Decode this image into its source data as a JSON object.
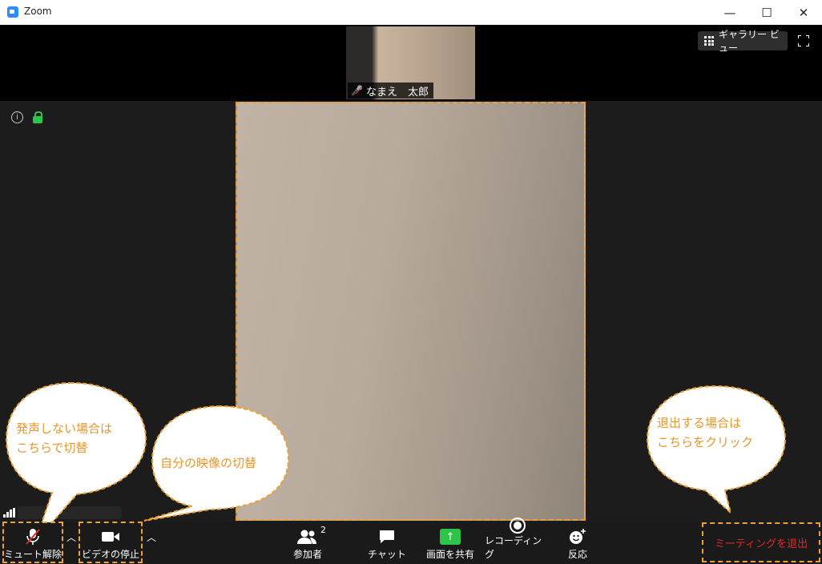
{
  "window": {
    "title": "Zoom",
    "minimize": "—",
    "maximize": "☐",
    "close": "✕"
  },
  "thumbnail": {
    "name": "なまえ　太郎"
  },
  "header": {
    "gallery_view": "ギャラリー ビュー"
  },
  "toolbar": {
    "unmute": "ミュート解除",
    "stop_video": "ビデオの停止",
    "participants": "参加者",
    "participant_count": "2",
    "chat": "チャット",
    "share_screen": "画面を共有",
    "recording": "レコーディング",
    "reactions": "反応",
    "leave": "ミーティングを退出"
  },
  "annotations": {
    "mute_line1": "発声しない場合は",
    "mute_line2": "こちらで切替",
    "video_line1": "自分の映像の切替",
    "leave_line1": "退出する場合は",
    "leave_line2": "こちらをクリック"
  },
  "colors": {
    "accent": "#f0a030",
    "annotation_text": "#e8962a",
    "leave_text": "#e02828",
    "share_green": "#2ec449"
  }
}
